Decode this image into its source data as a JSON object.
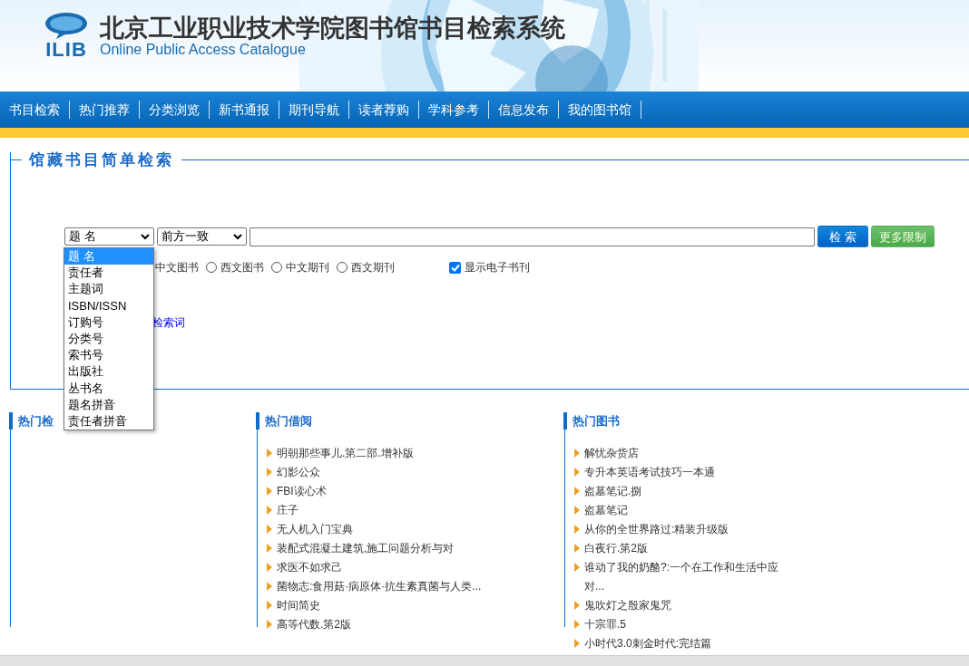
{
  "header": {
    "logo_text": "ILIB",
    "title": "北京工业职业技术学院图书馆书目检索系统",
    "subtitle": "Online Public Access Catalogue"
  },
  "nav": [
    {
      "label": "书目检索"
    },
    {
      "label": "热门推荐"
    },
    {
      "label": "分类浏览"
    },
    {
      "label": "新书通报"
    },
    {
      "label": "期刊导航"
    },
    {
      "label": "读者荐购"
    },
    {
      "label": "学科参考"
    },
    {
      "label": "信息发布"
    },
    {
      "label": "我的图书馆"
    }
  ],
  "search": {
    "legend": "馆藏书目简单检索",
    "field_select": {
      "value": "题 名",
      "expanded": true,
      "options": [
        {
          "label": "题 名",
          "selected": true
        },
        {
          "label": "责任者",
          "selected": false
        },
        {
          "label": "主题词",
          "selected": false
        },
        {
          "label": "ISBN/ISSN",
          "selected": false
        },
        {
          "label": "订购号",
          "selected": false
        },
        {
          "label": "分类号",
          "selected": false
        },
        {
          "label": "索书号",
          "selected": false
        },
        {
          "label": "出版社",
          "selected": false
        },
        {
          "label": "丛书名",
          "selected": false
        },
        {
          "label": "题名拼音",
          "selected": false
        },
        {
          "label": "责任者拼音",
          "selected": false
        }
      ]
    },
    "match_select": {
      "value": "前方一致"
    },
    "buttons": [
      {
        "label": "检 索",
        "kind": "primary"
      },
      {
        "label": "更多限制",
        "kind": "secondary"
      }
    ],
    "doc_types": [
      {
        "label": "中文图书",
        "kind": "label"
      },
      {
        "label": "西文图书",
        "kind": "radio",
        "selected": false
      },
      {
        "label": "中文期刊",
        "kind": "radio",
        "selected": false
      },
      {
        "label": "西文期刊",
        "kind": "radio",
        "selected": false
      }
    ],
    "ebook_checkbox": {
      "label": "显示电子书刊",
      "checked": true
    },
    "link": "检索词"
  },
  "panels": [
    {
      "title": "热门检"
    },
    {
      "title": "热门借阅",
      "items": [
        "明朝那些事儿.第二部.增补版",
        "幻影公众",
        "FBI读心术",
        "庄子",
        "无人机入门宝典",
        "装配式混凝土建筑,施工问题分析与对",
        "求医不如求己",
        "菌物志:食用菇·病原体·抗生素真菌与人类...",
        "时间简史",
        "高等代数.第2版"
      ]
    },
    {
      "title": "热门图书",
      "items": [
        "解忧杂货店",
        "专升本英语考试技巧一本通",
        "盗墓笔记.捌",
        "盗墓笔记",
        "从你的全世界路过:精装升级版",
        "白夜行.第2版",
        "谁动了我的奶酪?:一个在工作和生活中应对...",
        "鬼吹灯之殷家鬼咒",
        "十宗罪.5",
        "小时代3.0刺金时代:完结篇"
      ]
    }
  ]
}
